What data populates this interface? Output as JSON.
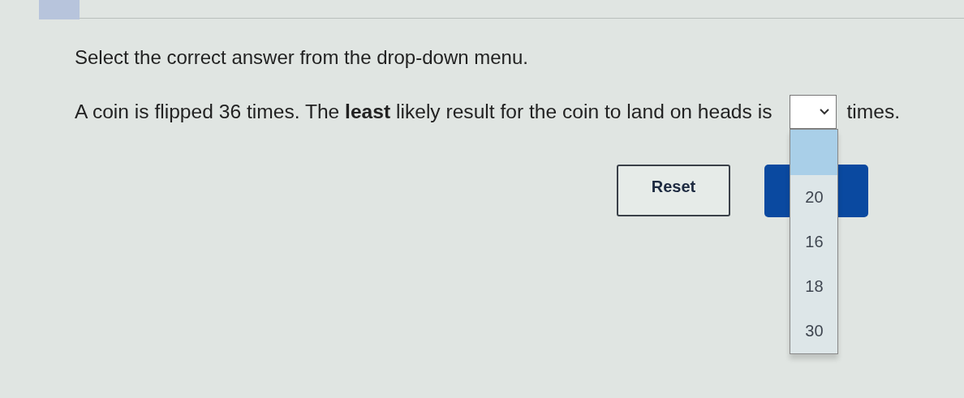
{
  "instruction": "Select the correct answer from the drop-down menu.",
  "question": {
    "before": "A coin is flipped 36 times. The **least** likely result for the coin to land on heads is",
    "after": "times."
  },
  "dropdown": {
    "expanded": true,
    "blank_option_highlighted": true,
    "options": [
      {
        "label": "20",
        "selected": false
      },
      {
        "label": "16",
        "selected": false
      },
      {
        "label": "18",
        "selected": false
      },
      {
        "label": "30",
        "selected": false
      }
    ]
  },
  "buttons": [
    {
      "kind": "outline",
      "label": "Reset"
    },
    {
      "kind": "primary"
    }
  ]
}
